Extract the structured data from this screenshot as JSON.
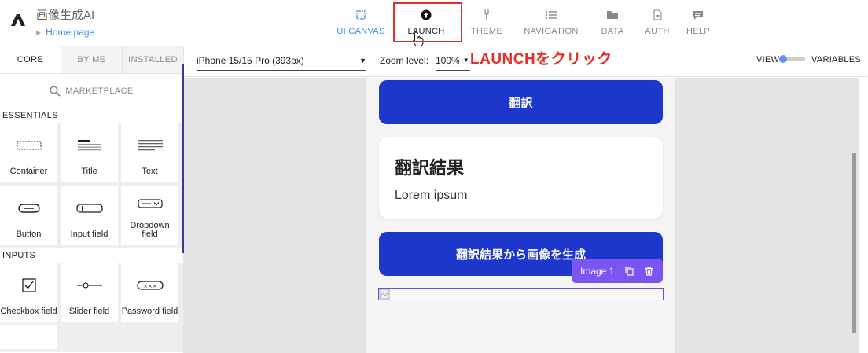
{
  "app": {
    "title": "画像生成AI",
    "breadcrumb": "Home page"
  },
  "nav": {
    "items": [
      {
        "label": "UI CANVAS",
        "icon": "canvas-icon"
      },
      {
        "label": "LAUNCH",
        "icon": "launch-icon"
      },
      {
        "label": "THEME",
        "icon": "brush-icon"
      },
      {
        "label": "NAVIGATION",
        "icon": "list-icon"
      },
      {
        "label": "DATA",
        "icon": "folder-icon"
      },
      {
        "label": "AUTH",
        "icon": "document-lock-icon"
      },
      {
        "label": "HELP",
        "icon": "chat-icon"
      }
    ]
  },
  "annotation": "LAUNCHをクリック",
  "left_panel": {
    "tabs": [
      "CORE",
      "BY ME",
      "INSTALLED"
    ],
    "marketplace": "MARKETPLACE",
    "essentials_heading": "ESSENTIALS",
    "essentials": [
      "Container",
      "Title",
      "Text",
      "Button",
      "Input field",
      "Dropdown field"
    ],
    "inputs_heading": "INPUTS",
    "inputs": [
      "Checkbox field",
      "Slider field",
      "Password field"
    ]
  },
  "toolbar": {
    "device": "iPhone 15/15 Pro (393px)",
    "zoom_label": "Zoom level:",
    "zoom_value": "100%",
    "view_label": "VIEW",
    "variables_label": "VARIABLES"
  },
  "canvas": {
    "translate_button": "翻訳",
    "card_title": "翻訳結果",
    "card_body": "Lorem ipsum",
    "generate_button": "翻訳結果から画像を生成",
    "image_tag": "Image 1"
  },
  "colors": {
    "accent": "#3a8ee6",
    "primary_button": "#1c37c9",
    "highlight": "#e0322a",
    "selection": "#7a55f0"
  }
}
